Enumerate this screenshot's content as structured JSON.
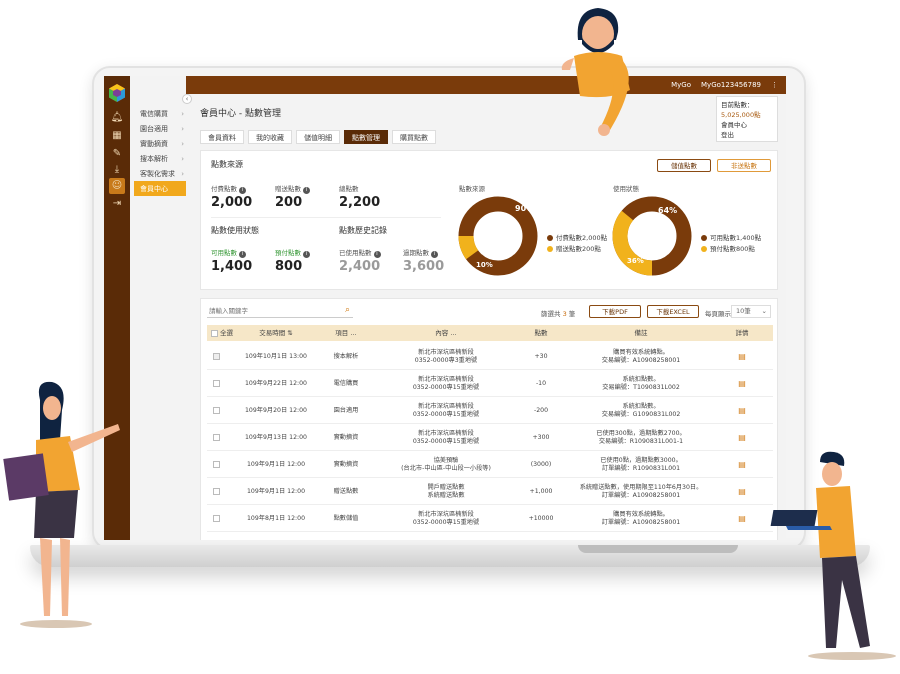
{
  "topbar": {
    "user": "MyGo",
    "account": "MyGo123456789",
    "menu_icon": "more-vertical-icon"
  },
  "dropdown": {
    "points_label": "目前點數：",
    "points_value": "5,025,000點",
    "member_center": "會員中心",
    "logout": "登出"
  },
  "sidebar": {
    "collapse_icon": "chevron-left-icon",
    "submenu": [
      {
        "label": "電信購買",
        "active": false
      },
      {
        "label": "園台適用",
        "active": false
      },
      {
        "label": "實動摘資",
        "active": false
      },
      {
        "label": "搜本解析",
        "active": false
      },
      {
        "label": "客製化需求",
        "active": false
      },
      {
        "label": "會員中心",
        "active": true
      }
    ]
  },
  "page": {
    "title": "會員中心 - 點數管理"
  },
  "tabs": [
    {
      "label": "會員資料",
      "active": false
    },
    {
      "label": "我的收藏",
      "active": false
    },
    {
      "label": "儲值明細",
      "active": false
    },
    {
      "label": "點數管理",
      "active": true
    },
    {
      "label": "購買點數",
      "active": false
    }
  ],
  "summary": {
    "source_title": "點數來源",
    "btn_transfer": "儲值點數",
    "btn_gift": "非送點數",
    "paid_label": "付費點數",
    "paid_value": "2,000",
    "gift_label": "贈送點數",
    "gift_value": "200",
    "total_label": "總點數",
    "total_value": "2,200",
    "usage_title": "點數使用狀態",
    "available_label": "可用點數",
    "available_value": "1,400",
    "reserved_label": "預付點數",
    "reserved_value": "800",
    "history_title": "點數歷史記錄",
    "used_label": "已使用點數",
    "used_value": "2,400",
    "expired_label": "過期點數",
    "expired_value": "3,600"
  },
  "donuts": {
    "source": {
      "title": "點數來源",
      "big_pct": "90%",
      "small_pct": "10%",
      "legend": [
        "付費點數2,000點",
        "贈送點數200點"
      ]
    },
    "usage": {
      "title": "使用狀態",
      "big_pct": "64%",
      "small_pct": "36%",
      "legend": [
        "可用點數1,400點",
        "預付點數800點"
      ]
    }
  },
  "colors": {
    "brown": "#7a3b0b",
    "gold": "#f1b21c",
    "dark": "#5a2b07"
  },
  "table": {
    "search_placeholder": "請輸入關鍵字",
    "selected_prefix": "篩選共",
    "selected_count": "3",
    "selected_suffix": "筆",
    "btn_pdf": "下載PDF",
    "btn_excel": "下載EXCEL",
    "per_page_label": "每頁顯示",
    "per_page_value": "10筆",
    "headers": [
      "全選",
      "交易時間",
      "項目",
      "內容",
      "點數",
      "備註",
      "詳情"
    ],
    "rows": [
      {
        "time": "109年10月1日 13:00",
        "item": "搜本解析",
        "content1": "新北市深坑區楠新段",
        "content2": "0352-0000專3重地號",
        "points": "+30",
        "note1": "購買有效系統轉點。",
        "note2": "交易編號：A10908258001",
        "checked": true
      },
      {
        "time": "109年9月22日 12:00",
        "item": "電信購買",
        "content1": "新北市深坑區楠新段",
        "content2": "0352-0000專15重地號",
        "points": "-10",
        "note1": "系統扣點數。",
        "note2": "交易編號：T1090831L002",
        "checked": false
      },
      {
        "time": "109年9月20日 12:00",
        "item": "園台適用",
        "content1": "新北市深坑區楠新段",
        "content2": "0352-0000專15重地號",
        "points": "-200",
        "note1": "系統扣點數。",
        "note2": "交易編號：G1090831L002",
        "checked": false
      },
      {
        "time": "109年9月13日 12:00",
        "item": "實動摘資",
        "content1": "新北市深坑區楠新段",
        "content2": "0352-0000專15重地號",
        "points": "+300",
        "note1": "已使用300點，過期點數2700。",
        "note2": "交易編號：R1090831L001-1",
        "checked": false
      },
      {
        "time": "109年9月1日 12:00",
        "item": "實動摘資",
        "content1": "協美預驗",
        "content2": "(台北市-中山區-中山段一小段等)",
        "points": "(3000)",
        "note1": "已使用0點，過期點數3000。",
        "note2": "訂單編號：R1090831L001",
        "checked": false
      },
      {
        "time": "109年9月1日 12:00",
        "item": "贈送點數",
        "content1": "開戶贈送點數",
        "content2": "系統贈送點數",
        "points": "+1,000",
        "note1": "系統贈送點數，使用期限至110年6月30日。",
        "note2": "訂單編號：A10908258001",
        "checked": false
      },
      {
        "time": "109年8月1日 12:00",
        "item": "點數儲值",
        "content1": "新北市深坑區楠新段",
        "content2": "0352-0000專15重地號",
        "points": "+10000",
        "note1": "購買有效系統轉點。",
        "note2": "訂單編號：A10908258001",
        "checked": false
      }
    ]
  }
}
